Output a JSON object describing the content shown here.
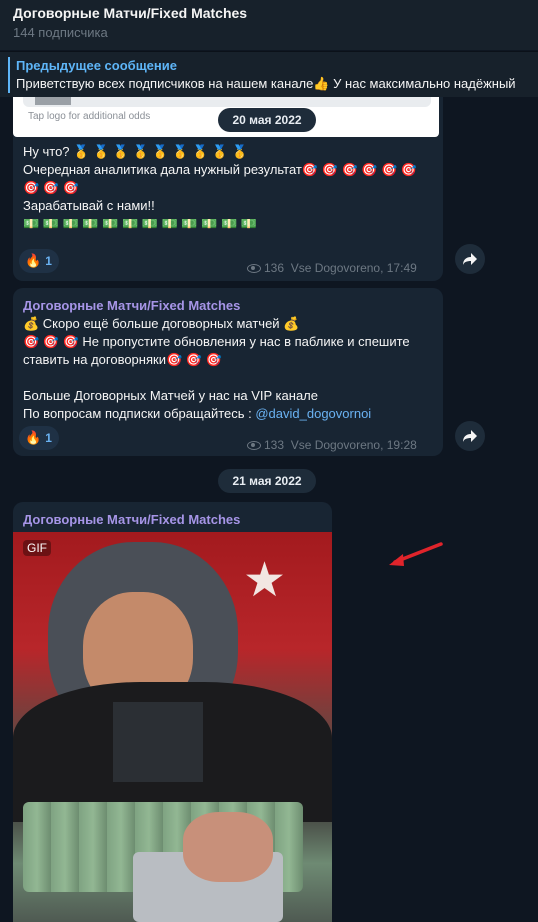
{
  "header": {
    "title": "Договорные Матчи/Fixed Matches",
    "subscribers": "144 подписчика"
  },
  "pinned": {
    "title": "Предыдущее сообщение",
    "text": "Приветствую всех подписчиков на нашем канале👍 У нас максимально надёжный"
  },
  "messages": [
    {
      "link_preview_hint": "Tap logo for additional odds",
      "date_pill": "20 мая 2022",
      "lines": [
        "Ну что? 🥇 🥇 🥇 🥇 🥇 🥇 🥇 🥇 🥇",
        "Очередная аналитика дала нужный результат🎯 🎯 🎯 🎯 🎯 🎯",
        "🎯 🎯 🎯",
        "Зарабатывай с нами!!",
        "💵 💵 💵 💵 💵 💵 💵 💵 💵 💵 💵 💵"
      ],
      "reaction": {
        "emoji": "🔥",
        "count": "1"
      },
      "views": "136",
      "signature_time": "Vse Dogovoreno, 17:49"
    },
    {
      "author": "Договорные Матчи/Fixed Matches",
      "lines": [
        "💰 Скоро ещё больше договорных матчей 💰",
        "🎯 🎯 🎯 Не пропустите обновления у нас в паблике и спешите",
        "ставить на договорняки🎯 🎯 🎯",
        "",
        "Больше Договорных Матчей у нас на VIP канале",
        "По вопросам подписки обращайтесь : "
      ],
      "mention": "@david_dogovornoi",
      "reaction": {
        "emoji": "🔥",
        "count": "1"
      },
      "views": "133",
      "signature_time": "Vse Dogovoreno, 19:28"
    },
    {
      "date_pill": "21 мая 2022",
      "author": "Договорные Матчи/Fixed Matches",
      "media_badge": "GIF"
    }
  ],
  "icons": {
    "share": "share-arrow-icon",
    "views": "eye-icon",
    "annotation": "red-arrow-annotation"
  },
  "colors": {
    "background": "#0e1621",
    "bubble": "#182533",
    "accent": "#5eb5f7",
    "author": "#a695e7",
    "annotation_arrow": "#e0242b"
  }
}
